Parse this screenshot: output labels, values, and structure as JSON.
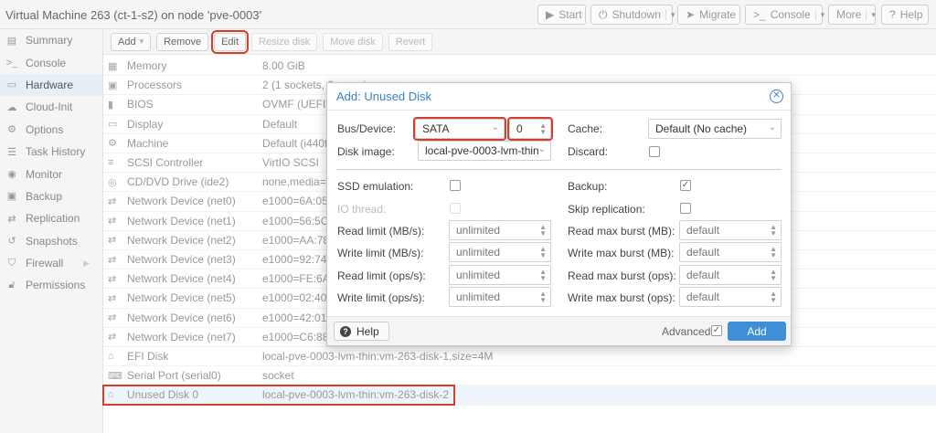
{
  "window": {
    "title": "Virtual Machine 263 (ct-1-s2) on node 'pve-0003'",
    "buttons": {
      "start": "Start",
      "shutdown": "Shutdown",
      "migrate": "Migrate",
      "console": "Console",
      "more": "More",
      "help": "Help"
    }
  },
  "sidebar": {
    "items": [
      {
        "label": "Summary",
        "icon": "book-icon"
      },
      {
        "label": "Console",
        "icon": "terminal-icon"
      },
      {
        "label": "Hardware",
        "icon": "monitor-icon"
      },
      {
        "label": "Cloud-Init",
        "icon": "cloud-icon"
      },
      {
        "label": "Options",
        "icon": "gear-icon"
      },
      {
        "label": "Task History",
        "icon": "list-icon"
      },
      {
        "label": "Monitor",
        "icon": "eye-icon"
      },
      {
        "label": "Backup",
        "icon": "floppy-icon"
      },
      {
        "label": "Replication",
        "icon": "retweet-icon"
      },
      {
        "label": "Snapshots",
        "icon": "history-icon"
      },
      {
        "label": "Firewall",
        "icon": "shield-icon"
      },
      {
        "label": "Permissions",
        "icon": "unlock-icon"
      }
    ]
  },
  "toolbar": {
    "add": "Add",
    "remove": "Remove",
    "edit": "Edit",
    "resize": "Resize disk",
    "move": "Move disk",
    "revert": "Revert"
  },
  "hardware": [
    {
      "label": "Memory",
      "value": "8.00 GiB"
    },
    {
      "label": "Processors",
      "value": "2 (1 sockets, 2 cores)"
    },
    {
      "label": "BIOS",
      "value": "OVMF (UEFI)"
    },
    {
      "label": "Display",
      "value": "Default"
    },
    {
      "label": "Machine",
      "value": "Default (i440fx)"
    },
    {
      "label": "SCSI Controller",
      "value": "VirtIO SCSI"
    },
    {
      "label": "CD/DVD Drive (ide2)",
      "value": "none,media=cdrom"
    },
    {
      "label": "Network Device (net0)",
      "value": "e1000=6A:05"
    },
    {
      "label": "Network Device (net1)",
      "value": "e1000=56:5C"
    },
    {
      "label": "Network Device (net2)",
      "value": "e1000=AA:78"
    },
    {
      "label": "Network Device (net3)",
      "value": "e1000=92:74"
    },
    {
      "label": "Network Device (net4)",
      "value": "e1000=FE:6A"
    },
    {
      "label": "Network Device (net5)",
      "value": "e1000=02:40"
    },
    {
      "label": "Network Device (net6)",
      "value": "e1000=42:01"
    },
    {
      "label": "Network Device (net7)",
      "value": "e1000=C6:88"
    },
    {
      "label": "EFI Disk",
      "value": "local-pve-0003-lvm-thin:vm-263-disk-1,size=4M"
    },
    {
      "label": "Serial Port (serial0)",
      "value": "socket"
    },
    {
      "label": "Unused Disk 0",
      "value": "local-pve-0003-lvm-thin:vm-263-disk-2"
    }
  ],
  "dialog": {
    "title": "Add: Unused Disk",
    "bus_label": "Bus/Device:",
    "bus_value": "SATA",
    "device_value": "0",
    "cache_label": "Cache:",
    "cache_value": "Default (No cache)",
    "image_label": "Disk image:",
    "image_value": "local-pve-0003-lvm-thin",
    "discard_label": "Discard:",
    "ssd_label": "SSD emulation:",
    "backup_label": "Backup:",
    "iothread_label": "IO thread:",
    "skiprep_label": "Skip replication:",
    "read_mb_label": "Read limit (MB/s):",
    "read_mb_burst_label": "Read max burst (MB):",
    "write_mb_label": "Write limit (MB/s):",
    "write_mb_burst_label": "Write max burst (MB):",
    "read_ops_label": "Read limit (ops/s):",
    "read_ops_burst_label": "Read max burst (ops):",
    "write_ops_label": "Write limit (ops/s):",
    "write_ops_burst_label": "Write max burst (ops):",
    "limit_placeholder": "unlimited",
    "burst_placeholder": "default",
    "help": "Help",
    "advanced": "Advanced",
    "add": "Add"
  },
  "colors": {
    "accent": "#3f8fd7",
    "highlight": "#d0402d"
  }
}
